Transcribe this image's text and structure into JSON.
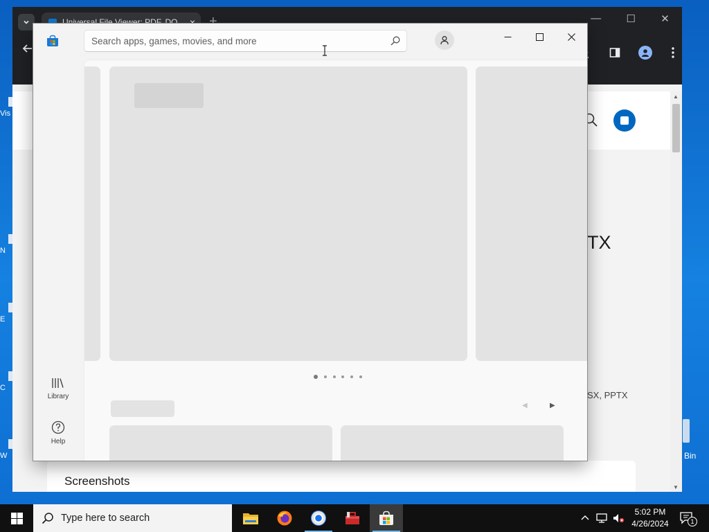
{
  "desktop": {
    "icon_fragments": [
      "Vis",
      "N",
      "E",
      "C",
      "W"
    ],
    "recycle_bin_fragment": "Bin"
  },
  "chrome": {
    "tab_title": "Universal File Viewer: PDF, DO",
    "page_title_fragment": "TX",
    "formats_fragment": "SX, PPTX",
    "screenshots_heading": "Screenshots"
  },
  "store": {
    "search_placeholder": "Search apps, games, movies, and more",
    "nav": {
      "library_label": "Library",
      "help_label": "Help"
    },
    "carousel": {
      "page_count": 6,
      "active_index": 0
    }
  },
  "taskbar": {
    "search_placeholder": "Type here to search",
    "clock_time": "5:02 PM",
    "clock_date": "4/26/2024",
    "notification_count": "1"
  },
  "colors": {
    "desktop_blue": "#0a6fd0",
    "store_accent": "#0067c0",
    "taskbar": "#101010",
    "chrome_dark": "#202124"
  }
}
